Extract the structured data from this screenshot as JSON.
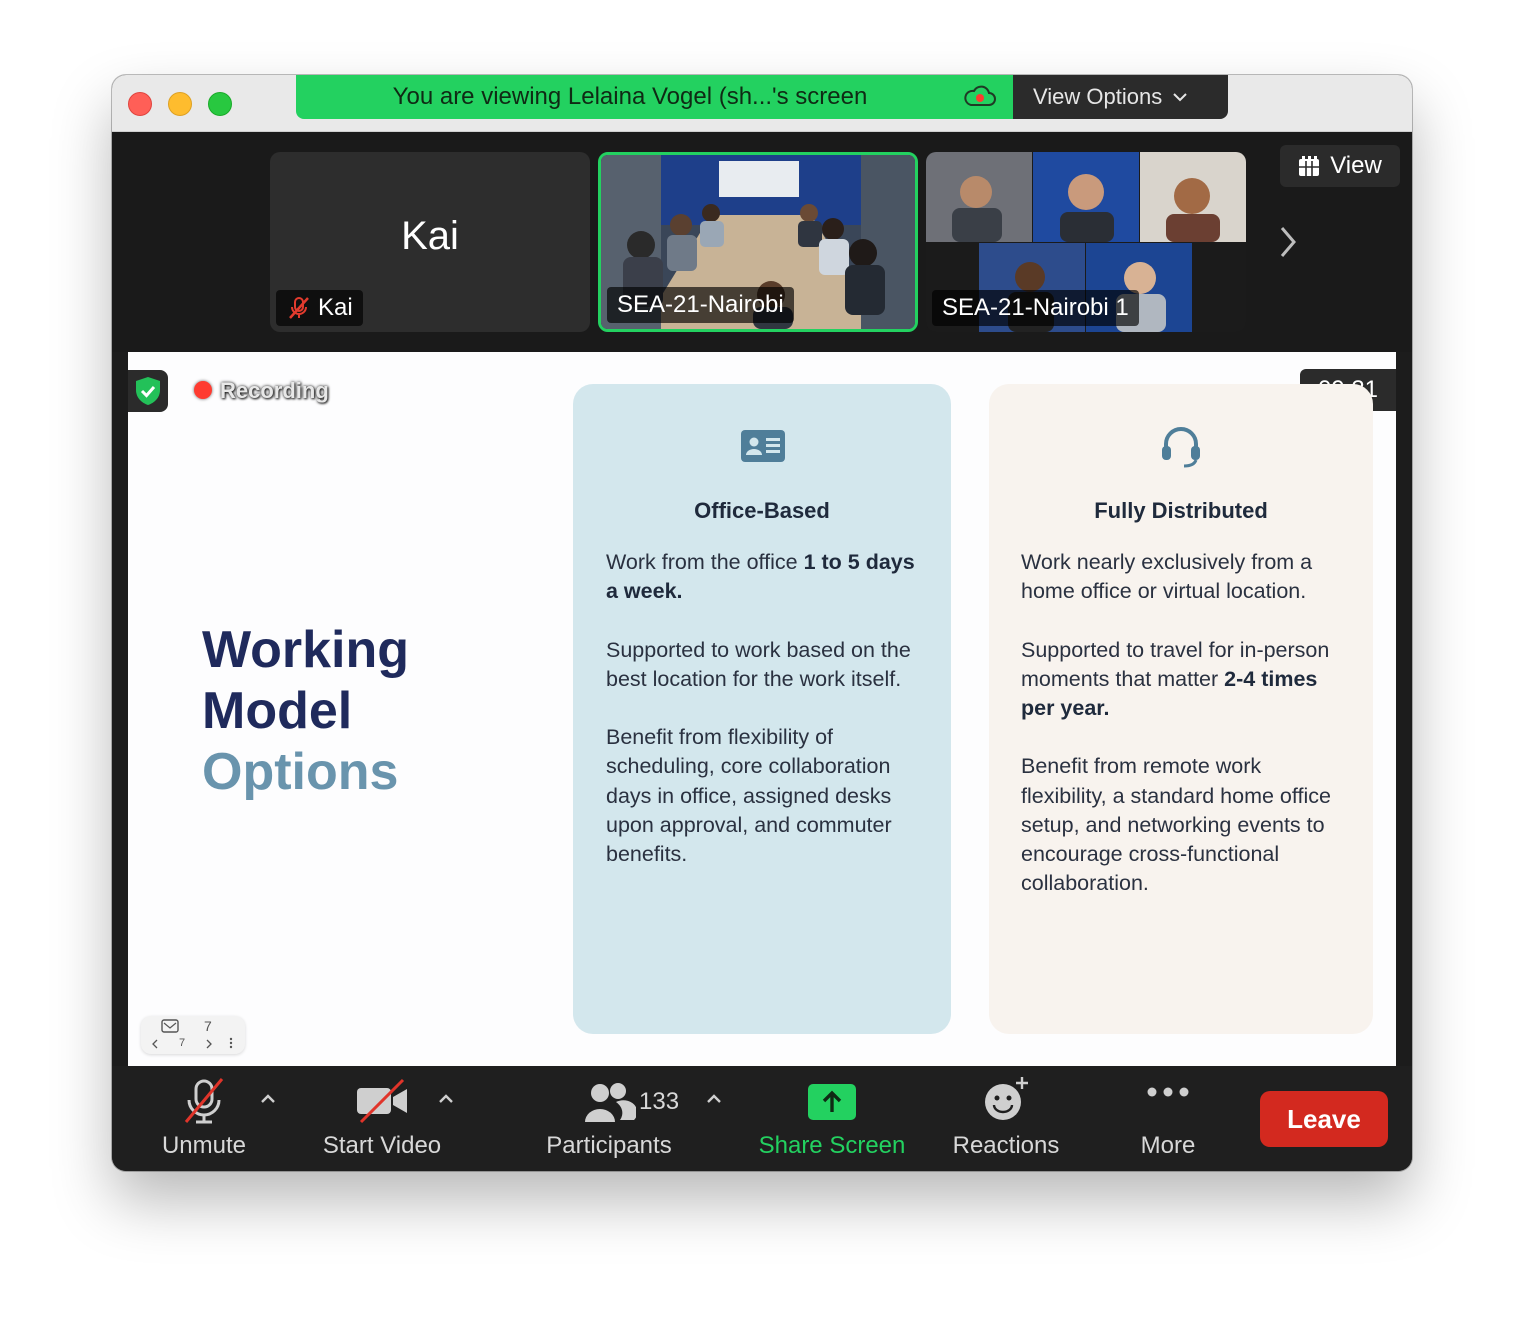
{
  "window": {
    "banner_text": "You are viewing Lelaina Vogel (sh...'s screen",
    "view_options_label": "View Options"
  },
  "gallery": {
    "view_label": "View",
    "tiles": [
      {
        "big_name": "Kai",
        "name": "Kai",
        "muted": true
      },
      {
        "name": "SEA-21-Nairobi",
        "active_speaker": true
      },
      {
        "name": "SEA-21-Nairobi 1"
      }
    ]
  },
  "shared_screen": {
    "recording_label": "Recording",
    "timer": "09:31",
    "page_number": "7",
    "page_indicator": "7",
    "slide": {
      "title_line1": "Working",
      "title_line2": "Model",
      "title_line3": "Options",
      "cards": [
        {
          "icon": "id-card-icon",
          "title": "Office-Based",
          "p1_a": "Work from the office ",
          "p1_b": "1 to 5 days a week.",
          "p2": "Supported to work based on the best location for the work itself.",
          "p3": "Benefit from flexibility of scheduling, core collaboration days in office, assigned desks upon approval, and commuter benefits."
        },
        {
          "icon": "headset-icon",
          "title": "Fully Distributed",
          "p1": "Work nearly exclusively from a home office or virtual location.",
          "p2_a": "Supported to travel for in-person moments that matter ",
          "p2_b": "2-4 times per year.",
          "p3": "Benefit from remote work flexibility, a standard home office setup, and networking events to encourage cross-functional collaboration."
        }
      ]
    }
  },
  "toolbar": {
    "unmute": "Unmute",
    "start_video": "Start Video",
    "participants_count": "133",
    "participants": "Participants",
    "share_screen": "Share Screen",
    "reactions": "Reactions",
    "more": "More",
    "leave": "Leave"
  },
  "colors": {
    "banner_green": "#23d160",
    "leave_red": "#d3291f",
    "title_navy": "#1f2a5c",
    "title_blue": "#6994ad",
    "office_card": "#d3e7ed",
    "distributed_card": "#f8f3ee"
  }
}
